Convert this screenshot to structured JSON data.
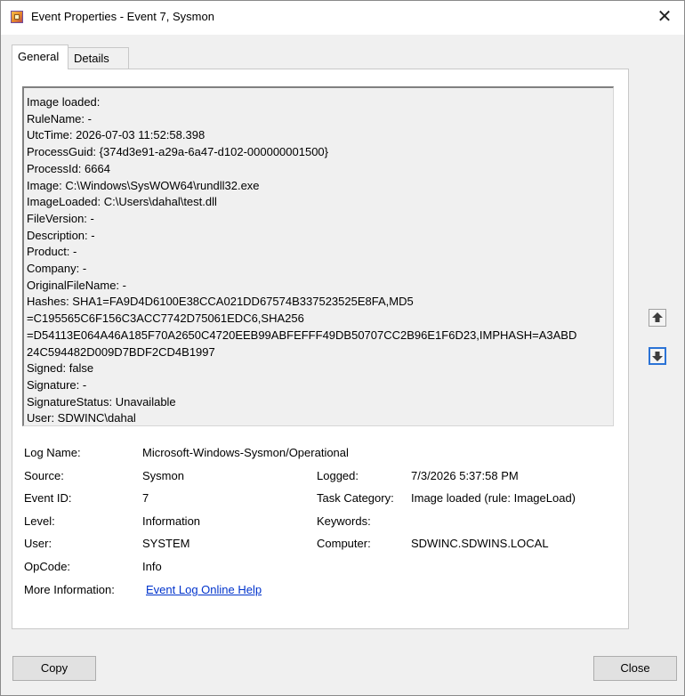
{
  "window": {
    "title": "Event Properties - Event 7, Sysmon"
  },
  "tabs": {
    "general": "General",
    "details": "Details"
  },
  "description_lines": [
    "Image loaded:",
    "RuleName: -",
    "UtcTime: 2026-07-03 11:52:58.398",
    "ProcessGuid: {374d3e91-a29a-6a47-d102-000000001500}",
    "ProcessId: 6664",
    "Image: C:\\Windows\\SysWOW64\\rundll32.exe",
    "ImageLoaded: C:\\Users\\dahal\\test.dll",
    "FileVersion: -",
    "Description: -",
    "Product: -",
    "Company: -",
    "OriginalFileName: -",
    "Hashes: SHA1=FA9D4D6100E38CCA021DD67574B337523525E8FA,MD5",
    "=C195565C6F156C3ACC7742D75061EDC6,SHA256",
    "=D54113E064A46A185F70A2650C4720EEB99ABFEFFF49DB50707CC2B96E1F6D23,IMPHASH=A3ABD",
    "24C594482D009D7BDF2CD4B1997",
    "Signed: false",
    "Signature: -",
    "SignatureStatus: Unavailable",
    "User: SDWINC\\dahal"
  ],
  "fields": {
    "log_name_label": "Log Name:",
    "log_name_value": "Microsoft-Windows-Sysmon/Operational",
    "source_label": "Source:",
    "source_value": "Sysmon",
    "logged_label": "Logged:",
    "logged_value": "7/3/2026 5:37:58 PM",
    "event_id_label": "Event ID:",
    "event_id_value": "7",
    "task_category_label": "Task Category:",
    "task_category_value": "Image loaded (rule: ImageLoad)",
    "level_label": "Level:",
    "level_value": "Information",
    "keywords_label": "Keywords:",
    "keywords_value": "",
    "user_label": "User:",
    "user_value": "SYSTEM",
    "computer_label": "Computer:",
    "computer_value": "SDWINC.SDWINS.LOCAL",
    "opcode_label": "OpCode:",
    "opcode_value": "Info",
    "more_info_label": "More Information:",
    "more_info_link": "Event Log Online Help"
  },
  "buttons": {
    "copy": "Copy",
    "close": "Close"
  },
  "icons": {
    "up": "arrow-up-icon",
    "down": "arrow-down-icon",
    "close": "close-icon",
    "app": "event-viewer-icon"
  },
  "colors": {
    "link": "#0033cc",
    "focus": "#2b73d6"
  }
}
